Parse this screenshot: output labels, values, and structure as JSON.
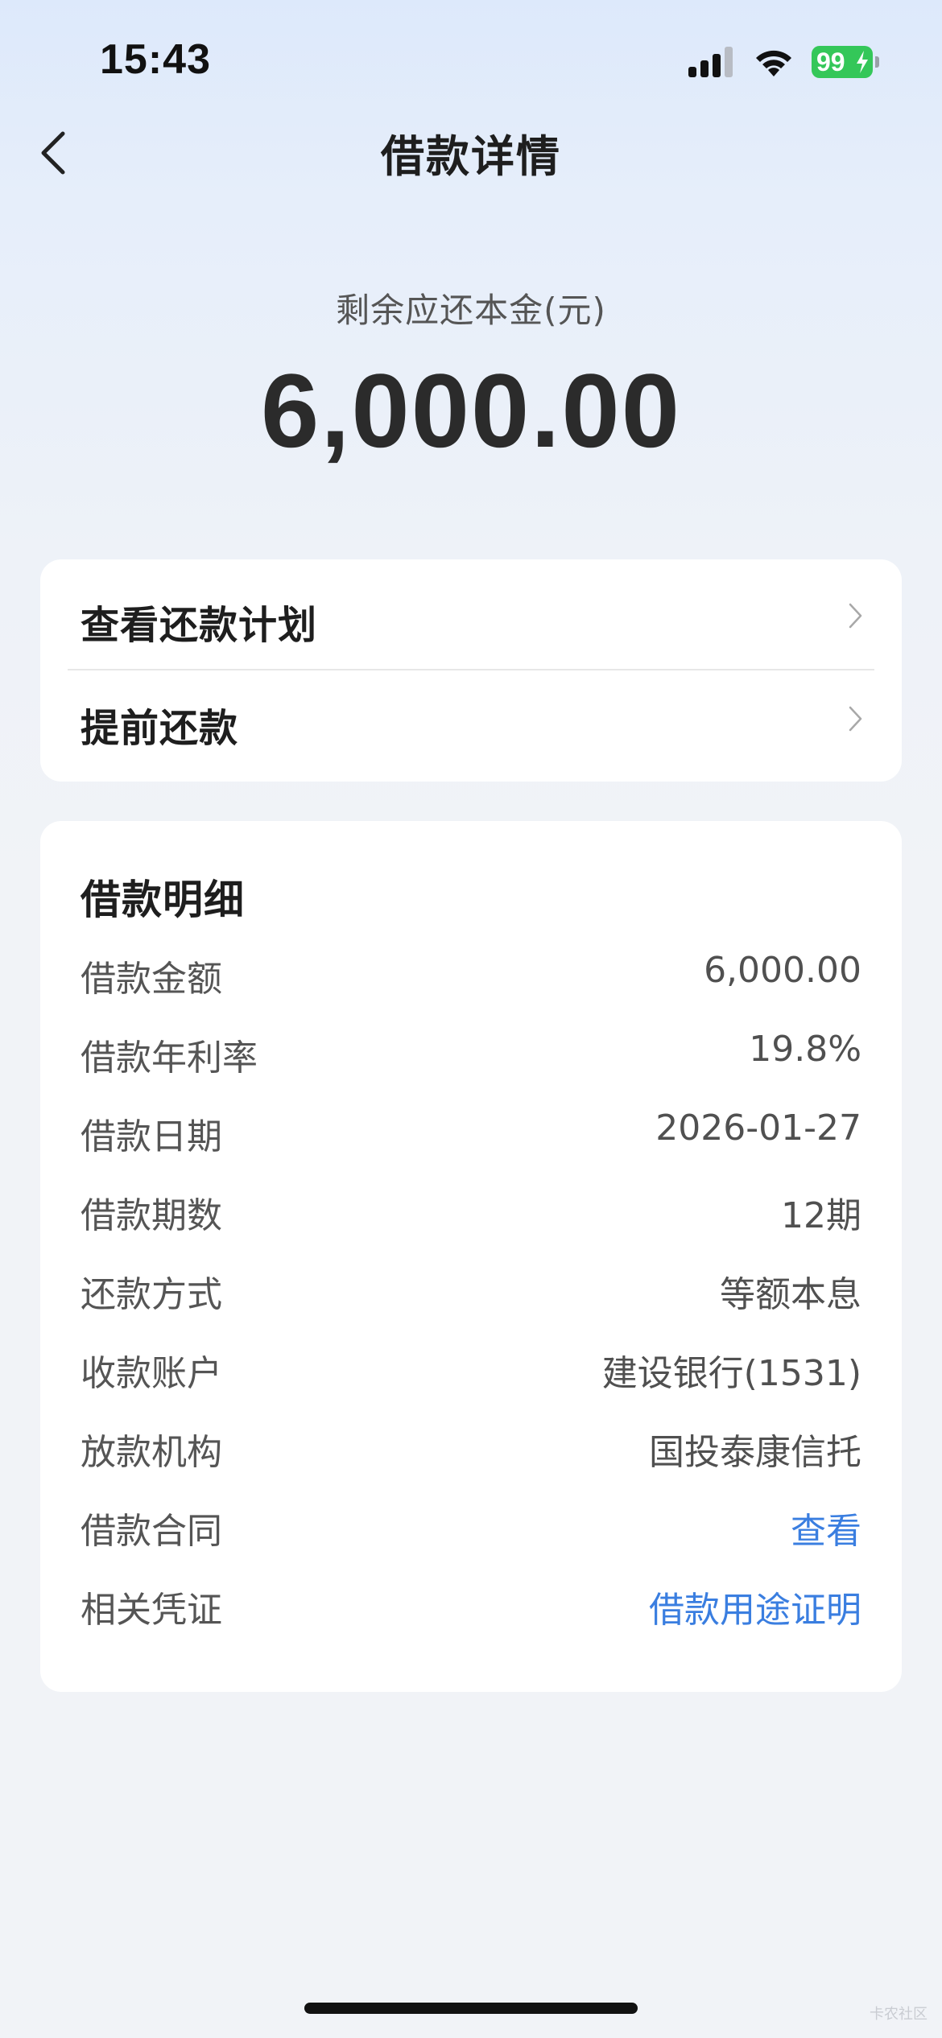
{
  "status_bar": {
    "time": "15:43",
    "battery": "99"
  },
  "nav": {
    "title": "借款详情"
  },
  "summary": {
    "label": "剩余应还本金(元)",
    "amount": "6,000.00"
  },
  "actions": [
    {
      "label": "查看还款计划"
    },
    {
      "label": "提前还款"
    }
  ],
  "details": {
    "title": "借款明细",
    "rows": [
      {
        "label": "借款金额",
        "value": "6,000.00"
      },
      {
        "label": "借款年利率",
        "value": "19.8%"
      },
      {
        "label": "借款日期",
        "value": "2026-01-27"
      },
      {
        "label": "借款期数",
        "value": "12期"
      },
      {
        "label": "还款方式",
        "value": "等额本息"
      },
      {
        "label": "收款账户",
        "value": "建设银行(1531)"
      },
      {
        "label": "放款机构",
        "value": "国投泰康信托"
      },
      {
        "label": "借款合同",
        "value": "查看"
      },
      {
        "label": "相关凭证",
        "value": "借款用途证明"
      }
    ]
  },
  "colors": {
    "link": "#3a7ee0",
    "battery": "#34c759"
  },
  "watermark": "卡农社区"
}
